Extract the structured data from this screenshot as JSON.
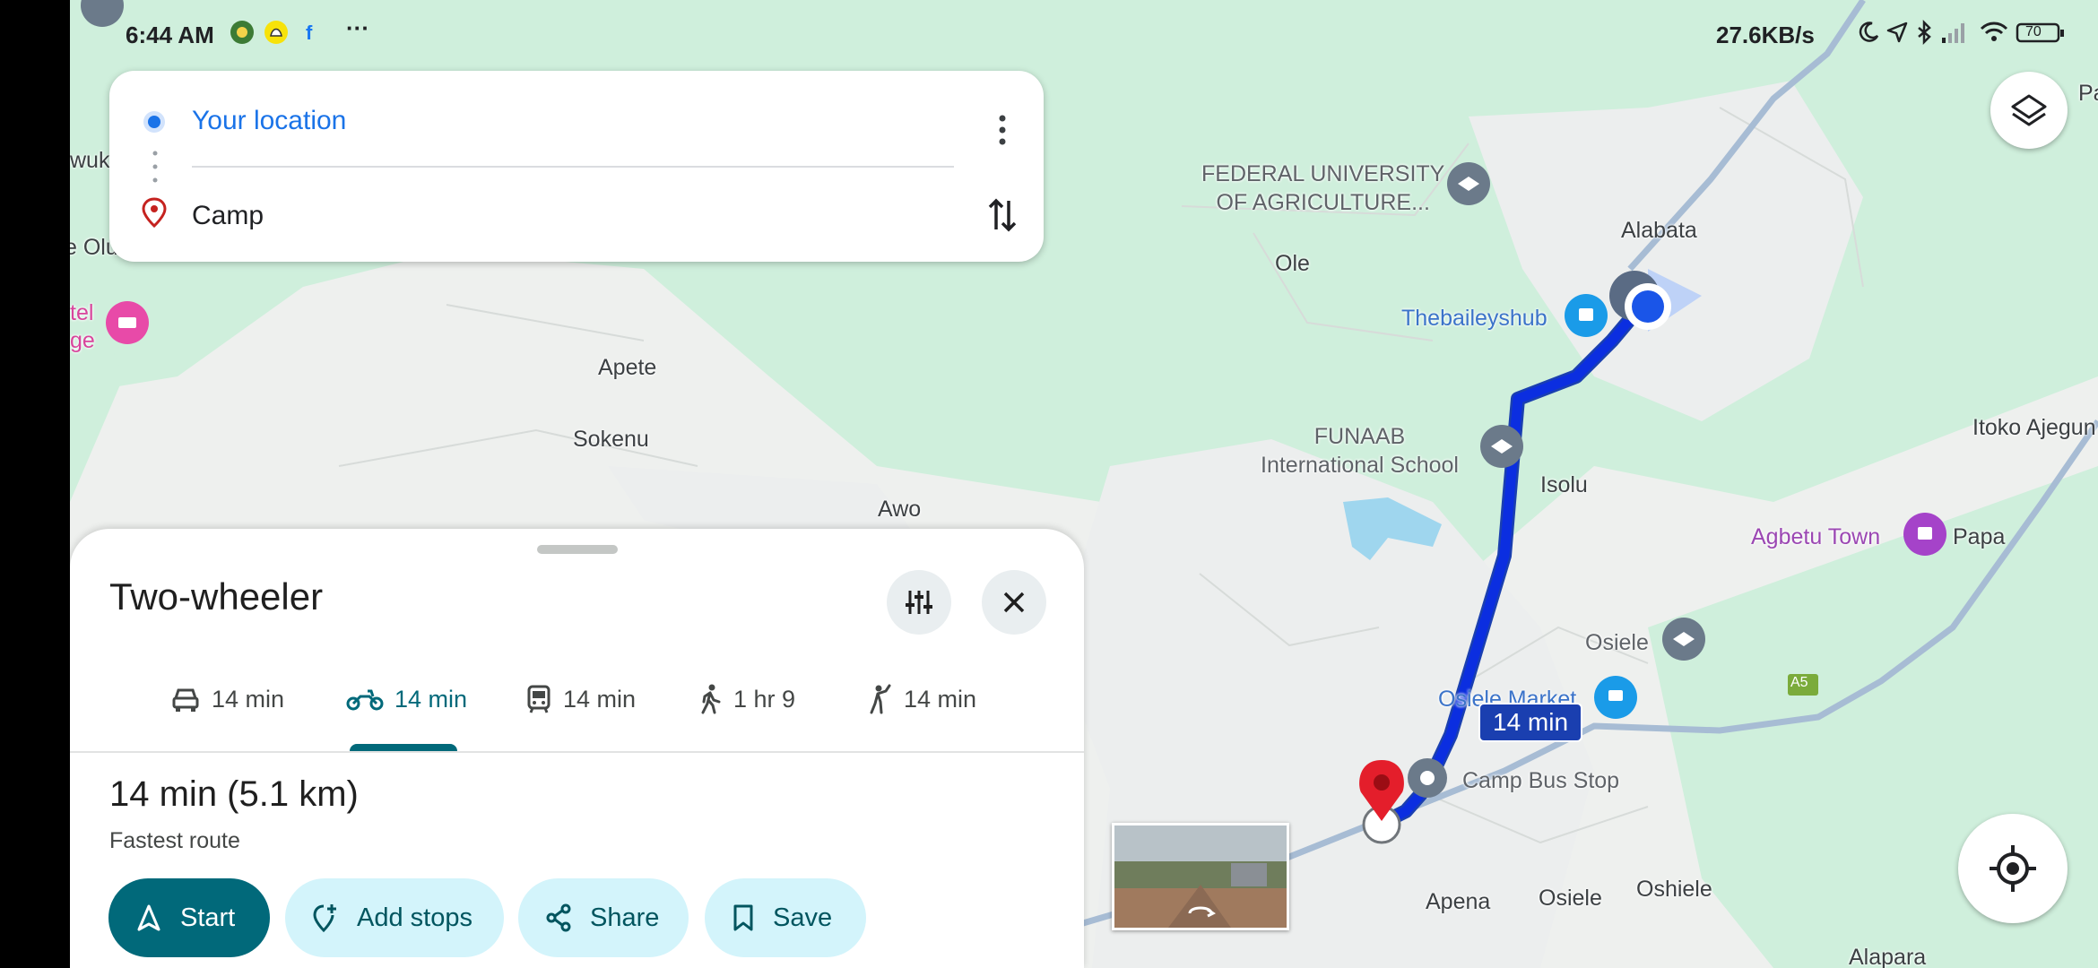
{
  "status_bar": {
    "time": "6:44 AM",
    "more": "···",
    "network_speed": "27.6KB/s",
    "battery": "70",
    "icons": [
      "chrome-icon",
      "snapchat-icon",
      "facebook-icon",
      "moon-icon",
      "location-arrow-icon",
      "bluetooth-icon",
      "signal-icon",
      "wifi-icon",
      "battery-icon"
    ]
  },
  "directions": {
    "origin": "Your location",
    "destination": "Camp",
    "origin_color": "#1a73e8",
    "destination_color": "#c5221f"
  },
  "map": {
    "labels": {
      "fed_uni_1": "FEDERAL UNIVERSITY",
      "fed_uni_2": "OF AGRICULTURE...",
      "ole": "Ole",
      "alabata": "Alabata",
      "thebaileyshub": "Thebaileyshub",
      "apete": "Apete",
      "sokenu": "Sokenu",
      "awo": "Awo",
      "funaab_1": "FUNAAB",
      "funaab_2": "International School",
      "isolu": "Isolu",
      "itoko": "Itoko Ajegun",
      "agbetu": "Agbetu Town",
      "papa": "Papa",
      "osiele_top": "Osiele",
      "osiele_market": "Osiele Market",
      "camp_bus_stop": "Camp Bus Stop",
      "apena": "Apena",
      "osiele_bottom": "Osiele",
      "oshiele": "Oshiele",
      "alapara": "Alapara",
      "edge_wuko": "wuko",
      "edge_olu": "e Olu",
      "edge_tel": "tel",
      "edge_ge": "ge",
      "edge_pa": "Pa",
      "road_a5": "A5"
    },
    "eta_badge": "14 min",
    "route_color": "#0b2ee0"
  },
  "sheet": {
    "title": "Two-wheeler",
    "modes": [
      {
        "icon": "car-icon",
        "label": "14 min",
        "active": false
      },
      {
        "icon": "motorcycle-icon",
        "label": "14 min",
        "active": true
      },
      {
        "icon": "transit-icon",
        "label": "14 min",
        "active": false
      },
      {
        "icon": "walk-icon",
        "label": "1 hr 9",
        "active": false
      },
      {
        "icon": "ride-hail-icon",
        "label": "14 min",
        "active": false
      }
    ],
    "route_summary": "14 min (5.1 km)",
    "route_note": "Fastest route",
    "actions": {
      "start": "Start",
      "add_stops": "Add stops",
      "share": "Share",
      "save": "Save"
    },
    "accent": "#01697a"
  }
}
